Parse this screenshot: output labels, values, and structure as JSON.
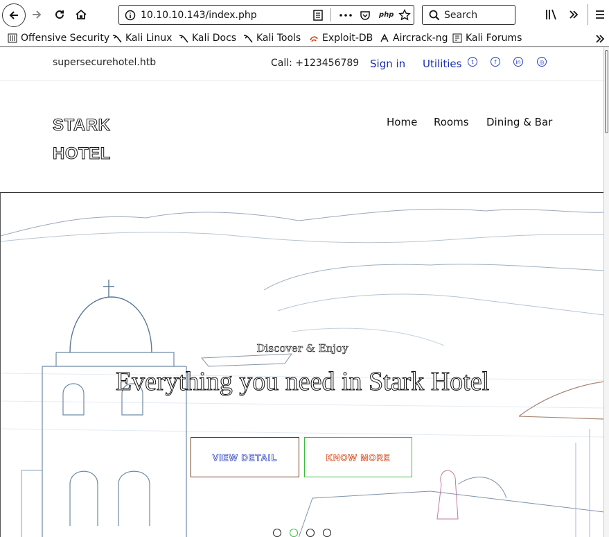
{
  "browser": {
    "url": "10.10.10.143/index.php",
    "search_placeholder": "Search",
    "bookmarks": [
      {
        "label": "Offensive Security"
      },
      {
        "label": "Kali Linux"
      },
      {
        "label": "Kali Docs"
      },
      {
        "label": "Kali Tools"
      },
      {
        "label": "Exploit-DB"
      },
      {
        "label": "Aircrack-ng"
      },
      {
        "label": "Kali Forums"
      }
    ]
  },
  "topbar": {
    "domain": "supersecurehotel.htb",
    "phone": "Call: +123456789",
    "signin": "Sign in",
    "utilities": "Utilities"
  },
  "brand": {
    "line1": "STARK",
    "line2": "HOTEL"
  },
  "menu": {
    "home": "Home",
    "rooms": "Rooms",
    "dining": "Dining & Bar"
  },
  "hero": {
    "kicker": "Discover & Enjoy",
    "headline": "Everything you need in Stark Hotel",
    "view_detail": "VIEW DETAIL",
    "know_more": "KNOW MORE",
    "slide_count": 4,
    "active_slide": 2
  },
  "colors": {
    "link": "#1a2fb0",
    "view_detail_text": "#2a3fc0",
    "know_more_text": "#d04010",
    "know_more_border": "#3cbc3c"
  }
}
